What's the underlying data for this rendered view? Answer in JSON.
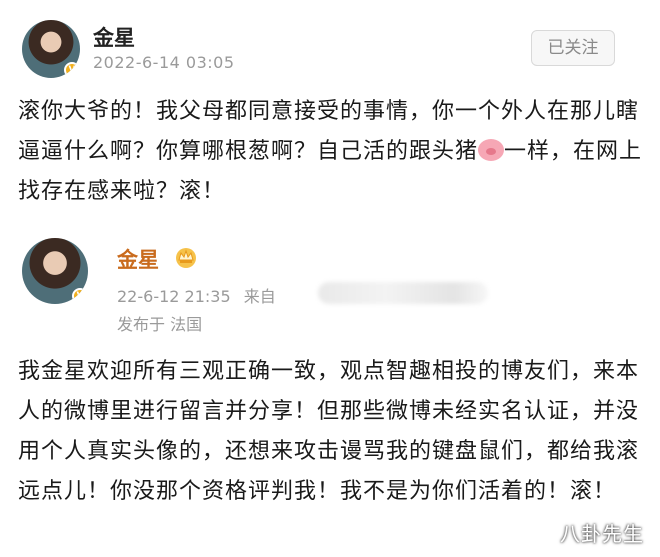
{
  "post1": {
    "name": "金星",
    "timestamp": "2022-6-14 03:05",
    "follow_button": "已关注",
    "body_before_emoji": "滚你大爷的！我父母都同意接受的事情，你一个外人在那儿瞎逼逼什么啊？你算哪根葱啊？自己活的跟头猪",
    "body_after_emoji": "一样，在网上找存在感来啦？滚！",
    "emoji": "pig-face-icon"
  },
  "post2": {
    "name": "金星",
    "timestamp": "22-6-12 21:35",
    "source_prefix": "来自",
    "location": "发布于 法国",
    "body": "我金星欢迎所有三观正确一致，观点智趣相投的博友们，来本人的微博里进行留言并分享！但那些微博未经实名认证，并没用个人真实头像的，还想来攻击谩骂我的键盘鼠们，都给我滚远点儿！你没那个资格评判我！我不是为你们活着的！滚！"
  },
  "watermark": "八卦先生",
  "colors": {
    "name_highlight": "#c96b1d",
    "timestamp": "#9a9a9a",
    "badge": "#f2b01e"
  }
}
